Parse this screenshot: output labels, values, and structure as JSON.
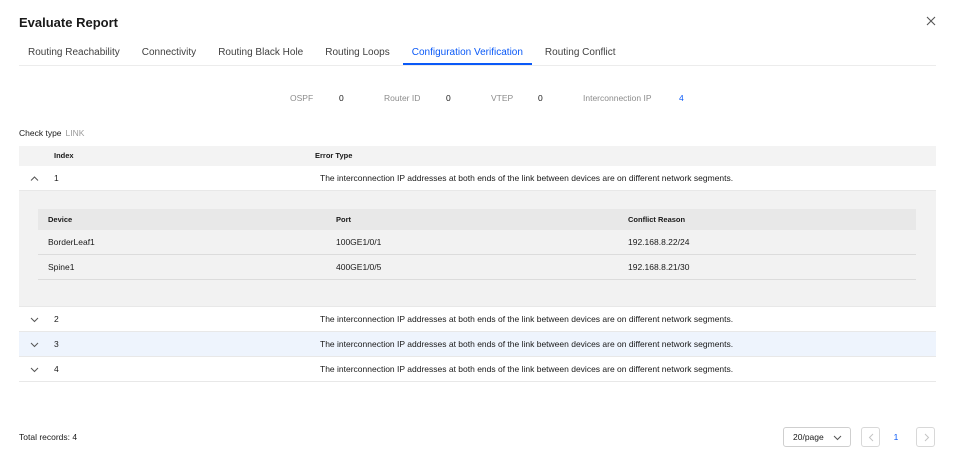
{
  "dialog": {
    "title": "Evaluate Report"
  },
  "tabs": [
    {
      "label": "Routing Reachability"
    },
    {
      "label": "Connectivity"
    },
    {
      "label": "Routing Black Hole"
    },
    {
      "label": "Routing Loops"
    },
    {
      "label": "Configuration Verification",
      "active": true
    },
    {
      "label": "Routing Conflict"
    }
  ],
  "summary": {
    "ospf_label": "OSPF",
    "ospf_value": "0",
    "router_id_label": "Router ID",
    "router_id_value": "0",
    "vtep_label": "VTEP",
    "vtep_value": "0",
    "interconnection_label": "Interconnection IP",
    "interconnection_value": "4"
  },
  "check_type": {
    "label": "Check type",
    "value": "LINK"
  },
  "table": {
    "headers": {
      "index": "Index",
      "error_type": "Error Type"
    },
    "rows": [
      {
        "index": "1",
        "error": "The interconnection IP addresses at both ends of the link between devices are on different network segments.",
        "expanded": true
      },
      {
        "index": "2",
        "error": "The interconnection IP addresses at both ends of the link between devices are on different network segments."
      },
      {
        "index": "3",
        "error": "The interconnection IP addresses at both ends of the link between devices are on different network segments."
      },
      {
        "index": "4",
        "error": "The interconnection IP addresses at both ends of the link between devices are on different network segments."
      }
    ],
    "detail": {
      "headers": {
        "device": "Device",
        "port": "Port",
        "reason": "Conflict Reason"
      },
      "rows": [
        {
          "device": "BorderLeaf1",
          "port": "100GE1/0/1",
          "reason": "192.168.8.22/24"
        },
        {
          "device": "Spine1",
          "port": "400GE1/0/5",
          "reason": "192.168.8.21/30"
        }
      ]
    }
  },
  "footer": {
    "total": "Total records: 4",
    "page_size": "20/page",
    "current_page": "1"
  },
  "colors": {
    "accent": "#0a59f7",
    "hover_row": "#eef4fd",
    "expanded_bg": "#f2f2f2"
  }
}
